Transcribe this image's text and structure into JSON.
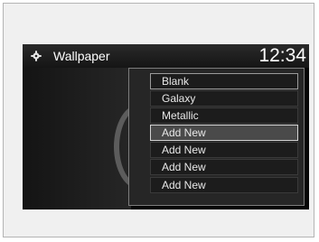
{
  "header": {
    "title": "Wallpaper",
    "clock": "12:34",
    "icon": "gear-icon"
  },
  "menu": {
    "items": [
      {
        "label": "Blank"
      },
      {
        "label": "Galaxy"
      },
      {
        "label": "Metallic"
      },
      {
        "label": "Add New",
        "selected": true
      },
      {
        "label": "Add New"
      },
      {
        "label": "Add New"
      },
      {
        "label": "Add New"
      }
    ]
  }
}
